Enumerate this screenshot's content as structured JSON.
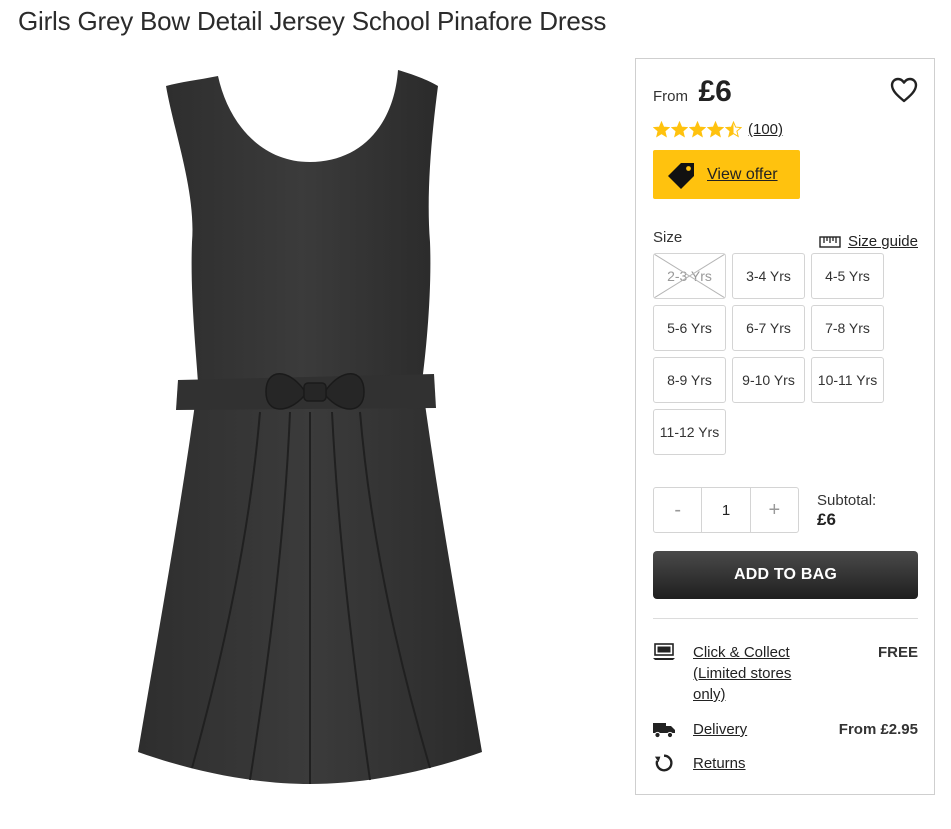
{
  "product": {
    "title": "Girls Grey Bow Detail Jersey School Pinafore Dress",
    "image_alt": "Grey jersey school pinafore dress with bow detail"
  },
  "price": {
    "prefix": "From",
    "value": "£6"
  },
  "rating": {
    "stars": 4.5,
    "max": 5,
    "count_label": "(100)",
    "star_color": "#ffc20e"
  },
  "offer": {
    "label": "View offer",
    "color": "#ffc20e"
  },
  "size": {
    "label": "Size",
    "guide_label": "Size guide",
    "options": [
      {
        "label": "2-3 Yrs",
        "available": false
      },
      {
        "label": "3-4 Yrs",
        "available": true
      },
      {
        "label": "4-5 Yrs",
        "available": true
      },
      {
        "label": "5-6 Yrs",
        "available": true
      },
      {
        "label": "6-7 Yrs",
        "available": true
      },
      {
        "label": "7-8 Yrs",
        "available": true
      },
      {
        "label": "8-9 Yrs",
        "available": true
      },
      {
        "label": "9-10 Yrs",
        "available": true
      },
      {
        "label": "10-11 Yrs",
        "available": true
      },
      {
        "label": "11-12 Yrs",
        "available": true
      }
    ]
  },
  "quantity": {
    "minus": "-",
    "value": "1",
    "plus": "+"
  },
  "subtotal": {
    "label": "Subtotal:",
    "value": "£6"
  },
  "add_to_bag": {
    "label": "ADD TO BAG"
  },
  "delivery_options": [
    {
      "icon": "click-collect-icon",
      "label": "Click & Collect (Limited stores only)",
      "value": "FREE"
    },
    {
      "icon": "delivery-truck-icon",
      "label": "Delivery",
      "value": "From £2.95"
    },
    {
      "icon": "returns-icon",
      "label": "Returns",
      "value": ""
    }
  ]
}
